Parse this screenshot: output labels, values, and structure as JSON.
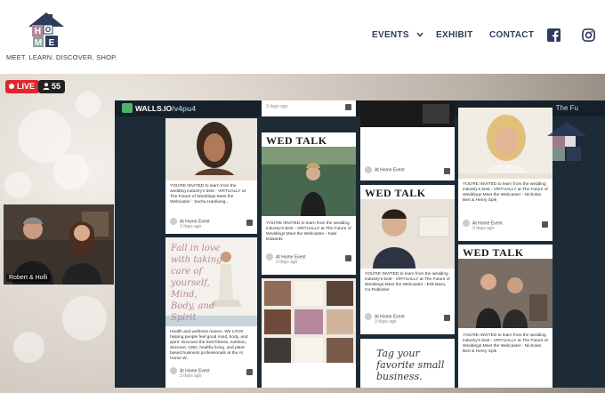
{
  "brand": {
    "logo_letters": [
      "H",
      "O",
      "M",
      "E"
    ],
    "tagline": "MEET. LEARN. DISCOVER. SHOP."
  },
  "nav": {
    "items": [
      {
        "label": "EVENTS",
        "has_dropdown": true
      },
      {
        "label": "EXHIBIT"
      },
      {
        "label": "CONTACT"
      }
    ],
    "social": [
      "facebook-icon",
      "instagram-icon"
    ]
  },
  "stream": {
    "live_label": "LIVE",
    "viewer_count": "55",
    "camera_label": "Robert & Holli"
  },
  "wall": {
    "brand": "WALLS.IO",
    "handle": "/v4pu4",
    "header_right": "The Fu",
    "posts": [
      {
        "badge": "WED TALK",
        "author": "At Home Event",
        "ago": "3 days ago",
        "text": "YOU'RE INVITED to learn from the wedding industry's best - VIRTUALLY at The Future of Weddings Meet the Webcaster - Sacha Hardiwrig..."
      },
      {
        "badge": "WED TALK",
        "author": "At Home Event",
        "ago": "3 days ago",
        "text": "YOU'RE INVITED to learn from the wedding industry's best - VIRTUALLY at The Future of Weddings Meet the Webcaster - Kate Edwards"
      },
      {
        "badge": "WED TALK",
        "author": "At Home Event",
        "ago": "3 days ago",
        "text": "YOU'RE INVITED to learn from the wedding industry's best - VIRTUALLY at The Future of Weddings Meet the Webcaster - Erik Bazu, Co-Publisher"
      },
      {
        "badge": "WED TALK",
        "author": "At Home Event",
        "ago": "3 days ago",
        "text": "YOU'RE INVITED to learn from the wedding industry's best - VIRTUALLY at The Future of Weddings Meet the Webcaster - Nicholas Bert & Henry Spik"
      },
      {
        "script": "Fall in love with taking care of yourself, Mind, Body, and Spirit",
        "author": "At Home Event",
        "ago": "3 days ago",
        "text": "Health and wellness maven. We LOVE helping people feel good mind, body, and spirit. Discover the best fitness, nutrition, skincare, CBD, healthy living, and plant-based business professionals at the At Home W..."
      },
      {
        "script": "Tag your favorite small business.",
        "author": "At Home Event",
        "ago": "3 days ago"
      }
    ]
  }
}
